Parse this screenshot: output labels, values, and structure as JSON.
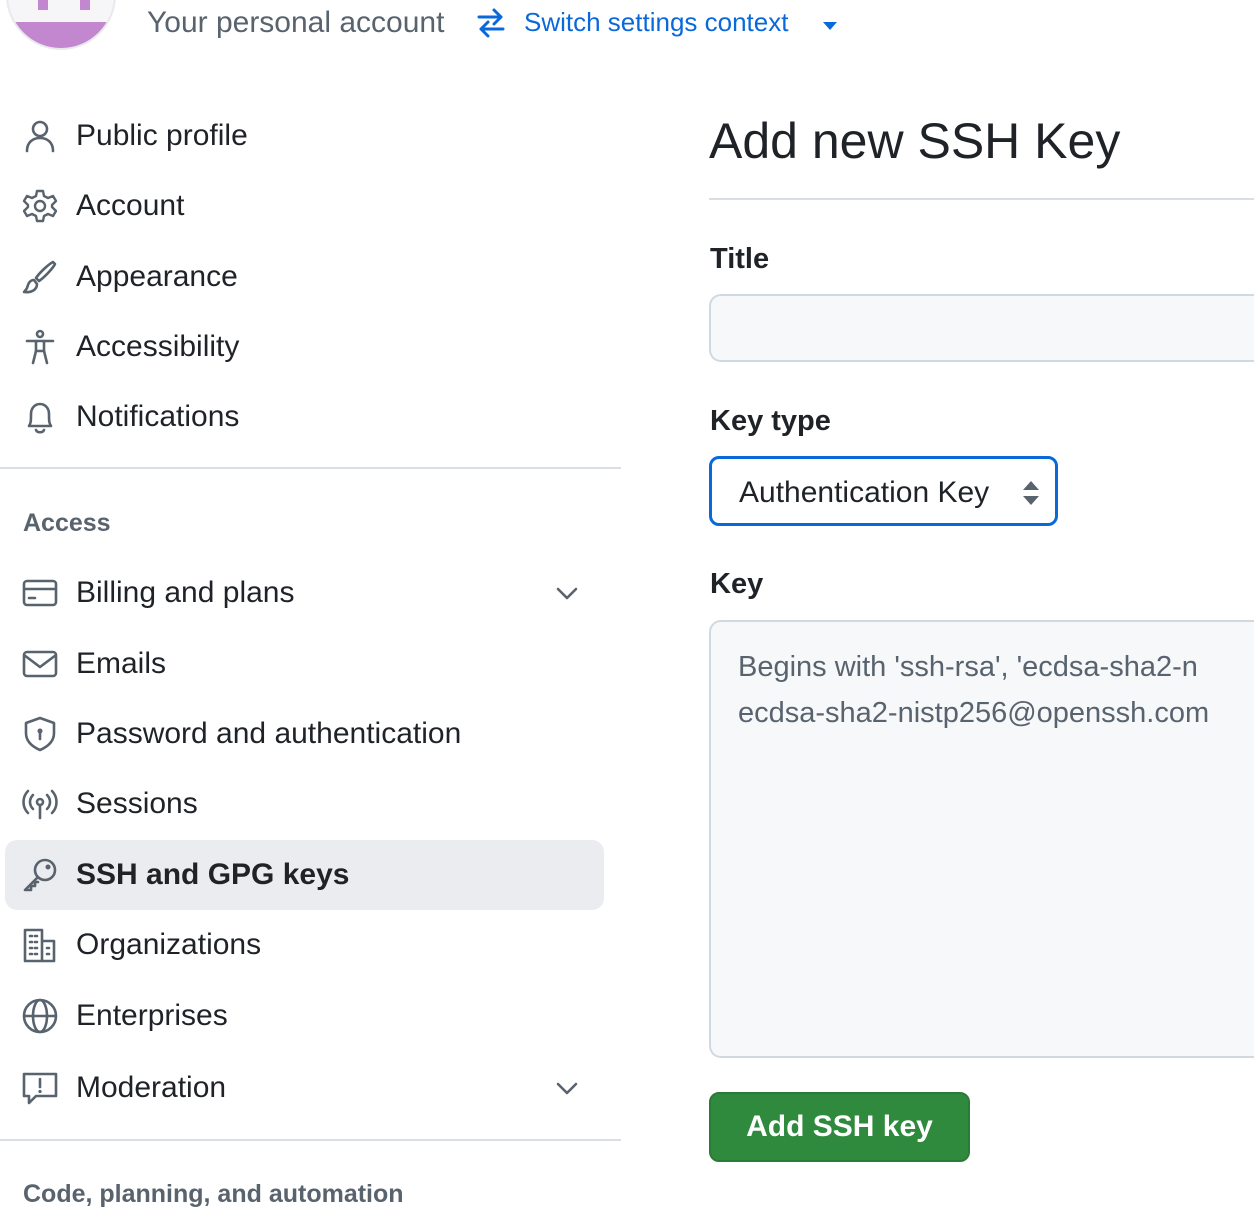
{
  "header": {
    "context_label": "Your personal account",
    "switch_link": "Switch settings context"
  },
  "sidebar": {
    "items": [
      {
        "label": "Public profile",
        "icon": "person-icon"
      },
      {
        "label": "Account",
        "icon": "gear-icon"
      },
      {
        "label": "Appearance",
        "icon": "paintbrush-icon"
      },
      {
        "label": "Accessibility",
        "icon": "accessibility-icon"
      },
      {
        "label": "Notifications",
        "icon": "bell-icon"
      }
    ],
    "access_heading": "Access",
    "access_items": [
      {
        "label": "Billing and plans",
        "icon": "credit-card-icon",
        "expandable": true
      },
      {
        "label": "Emails",
        "icon": "mail-icon"
      },
      {
        "label": "Password and authentication",
        "icon": "shield-icon"
      },
      {
        "label": "Sessions",
        "icon": "broadcast-icon"
      },
      {
        "label": "SSH and GPG keys",
        "icon": "key-icon",
        "active": true
      },
      {
        "label": "Organizations",
        "icon": "organization-icon"
      },
      {
        "label": "Enterprises",
        "icon": "globe-icon"
      },
      {
        "label": "Moderation",
        "icon": "report-icon",
        "expandable": true
      }
    ],
    "code_heading": "Code, planning, and automation"
  },
  "main": {
    "title": "Add new SSH Key",
    "title_field": {
      "label": "Title",
      "value": "",
      "placeholder": ""
    },
    "key_type": {
      "label": "Key type",
      "selected": "Authentication Key"
    },
    "key_field": {
      "label": "Key",
      "placeholder": "Begins with 'ssh-rsa', 'ecdsa-sha2-n\necdsa-sha2-nistp256@openssh.com"
    },
    "submit_label": "Add SSH key"
  },
  "colors": {
    "accent": "#0969da",
    "active_bg": "#eaecef",
    "button_green": "#2f8a3e",
    "avatar_purple": "#c287cf"
  }
}
